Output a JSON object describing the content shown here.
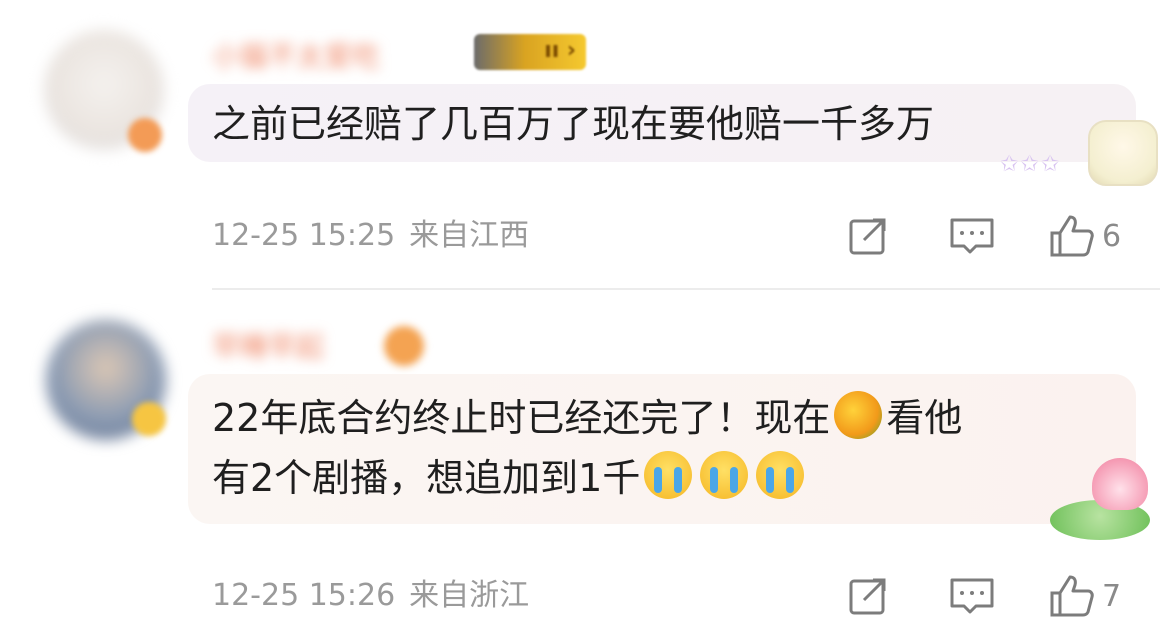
{
  "comments": [
    {
      "username": "小猫不太爱吃",
      "content": "之前已经赔了几百万了现在要他赔一千多万",
      "timestamp": "12-25 15:25",
      "location": "来自江西",
      "likes": "6",
      "decoration": "bear-sticker"
    },
    {
      "username": "早睡早起",
      "content_line1": "22年底合约终止时已经还完了！现在",
      "content_line1_after": "看他",
      "content_line2": "有2个剧播，想追加到1千",
      "timestamp": "12-25 15:26",
      "location": "来自浙江",
      "likes": "7",
      "decoration": "lotus-sticker"
    }
  ],
  "icons": {
    "share": "share-icon",
    "reply": "comment-icon",
    "like": "thumbs-up-icon"
  },
  "colors": {
    "meta": "#9a9a9a",
    "content": "#1f1f1f",
    "bubble1": "#f5f1f7",
    "bubble2": "#fbf4f1"
  }
}
